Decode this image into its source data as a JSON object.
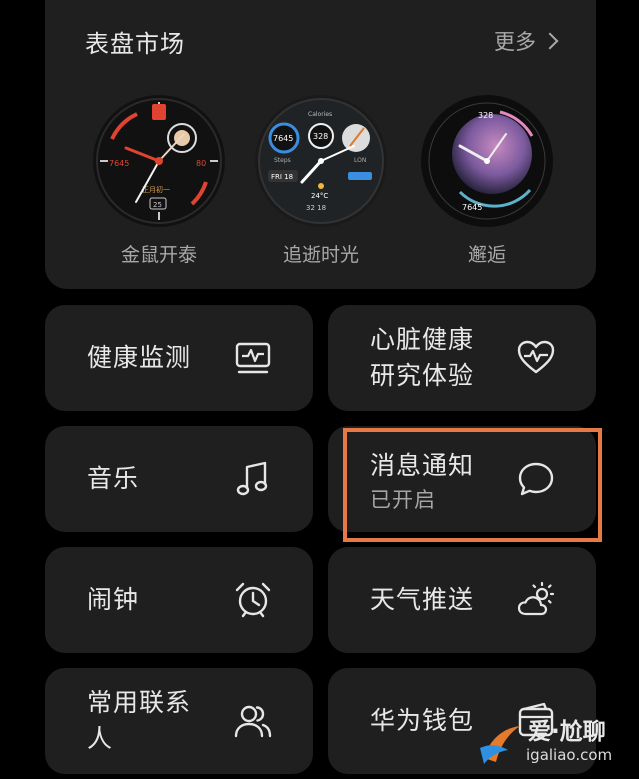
{
  "market": {
    "title": "表盘市场",
    "more_label": "更多",
    "faces": [
      {
        "label": "金鼠开泰",
        "data_left": "7645",
        "data_right": "80",
        "date": "正月初一",
        "day": "25"
      },
      {
        "label": "追逝时光",
        "top": "Calories",
        "left_value": "7645",
        "mid_value": "328",
        "left_sub": "Steps",
        "right_sub": "LON",
        "date": "FRI 18",
        "temp": "24°C",
        "bottom": "32  18"
      },
      {
        "label": "邂逅",
        "top_value": "328",
        "bottom_value": "7645"
      }
    ]
  },
  "tiles": [
    {
      "label": "健康监测",
      "icon": "health-monitor-icon"
    },
    {
      "label_line1": "心脏健康",
      "label_line2": "研究体验",
      "icon": "heart-pulse-icon"
    },
    {
      "label": "音乐",
      "icon": "music-note-icon"
    },
    {
      "label": "消息通知",
      "sub": "已开启",
      "icon": "chat-bubble-icon"
    },
    {
      "label": "闹钟",
      "icon": "alarm-clock-icon"
    },
    {
      "label": "天气推送",
      "icon": "weather-sun-cloud-icon"
    },
    {
      "label_line1": "常用联系",
      "label_line2": "人",
      "icon": "contacts-icon"
    },
    {
      "label": "华为钱包",
      "icon": "wallet-icon"
    }
  ],
  "watermark": {
    "text": "爱·尬聊",
    "url": "igaliao.com"
  },
  "colors": {
    "background": "#000000",
    "card": "#1f1f1f",
    "highlight": "#e67a46",
    "text_primary": "#e8e8e8",
    "text_secondary": "#a8a8a8"
  }
}
